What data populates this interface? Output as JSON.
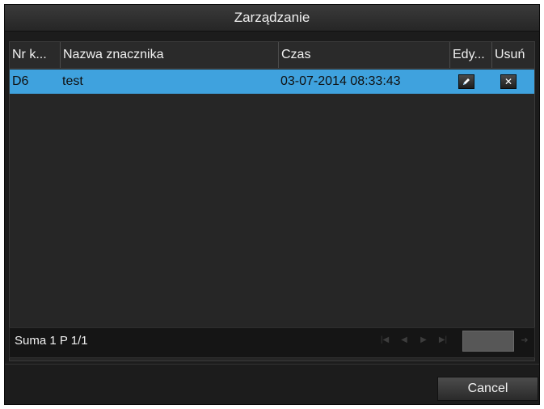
{
  "dialog": {
    "title": "Zarządzanie"
  },
  "table": {
    "columns": [
      "Nr k...",
      "Nazwa znacznika",
      "Czas",
      "Edy...",
      "Usuń"
    ],
    "rows": [
      {
        "nr": "D6",
        "name": "test",
        "time": "03-07-2014 08:33:43",
        "edit_icon": "pencil-icon",
        "delete_icon": "close-icon"
      }
    ]
  },
  "pager": {
    "summary": "Suma 1 P 1/1",
    "icons": [
      "first-page-icon",
      "prev-page-icon",
      "next-page-icon",
      "last-page-icon",
      "go-arrow-icon"
    ]
  },
  "footer": {
    "cancel_label": "Cancel"
  },
  "colors": {
    "selected_row": "#3fa2de",
    "background": "#1c1c1c"
  }
}
